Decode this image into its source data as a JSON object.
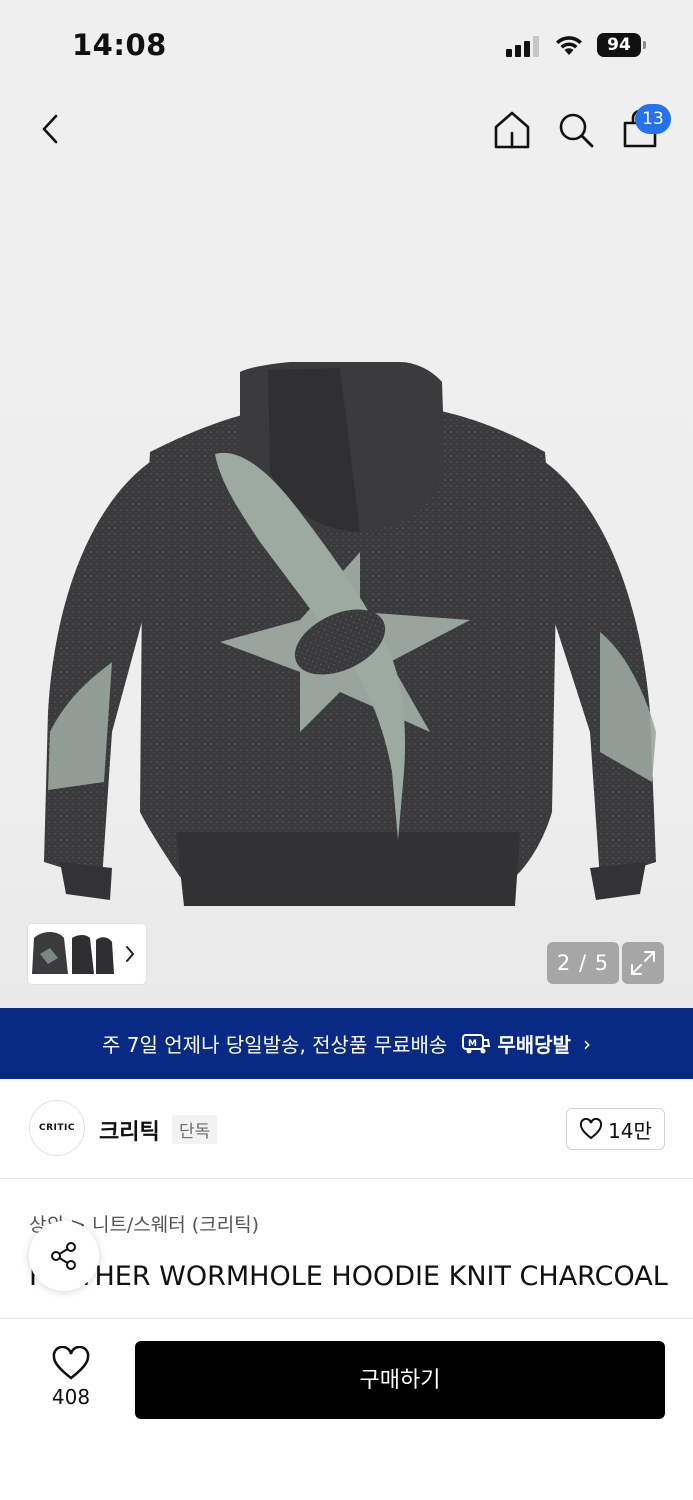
{
  "status_bar": {
    "time": "14:08",
    "battery": "94"
  },
  "nav": {
    "cart_count": "13",
    "icons": [
      "chevron-left-icon",
      "home-icon",
      "search-icon",
      "shopping-bag-icon"
    ]
  },
  "gallery": {
    "counter": "2 / 5",
    "current": 2,
    "total": 5
  },
  "promo": {
    "text": "주 7일 언제나 당일발송, 전상품 무료배송",
    "brand": "무배당발",
    "color": "#082a84"
  },
  "brand": {
    "logo_text": "CRITIC",
    "name": "크리틱",
    "tag": "단독",
    "likes": "14만"
  },
  "breadcrumb": "상의 > 니트/스웨터 (크리틱)",
  "product": {
    "title": "FEATHER WORMHOLE HOODIE KNIT CHARCOAL"
  },
  "bottom": {
    "wish_count": "408",
    "buy_label": "구매하기"
  },
  "colors": {
    "accent": "#2472f0",
    "buy_button": "#000000"
  }
}
